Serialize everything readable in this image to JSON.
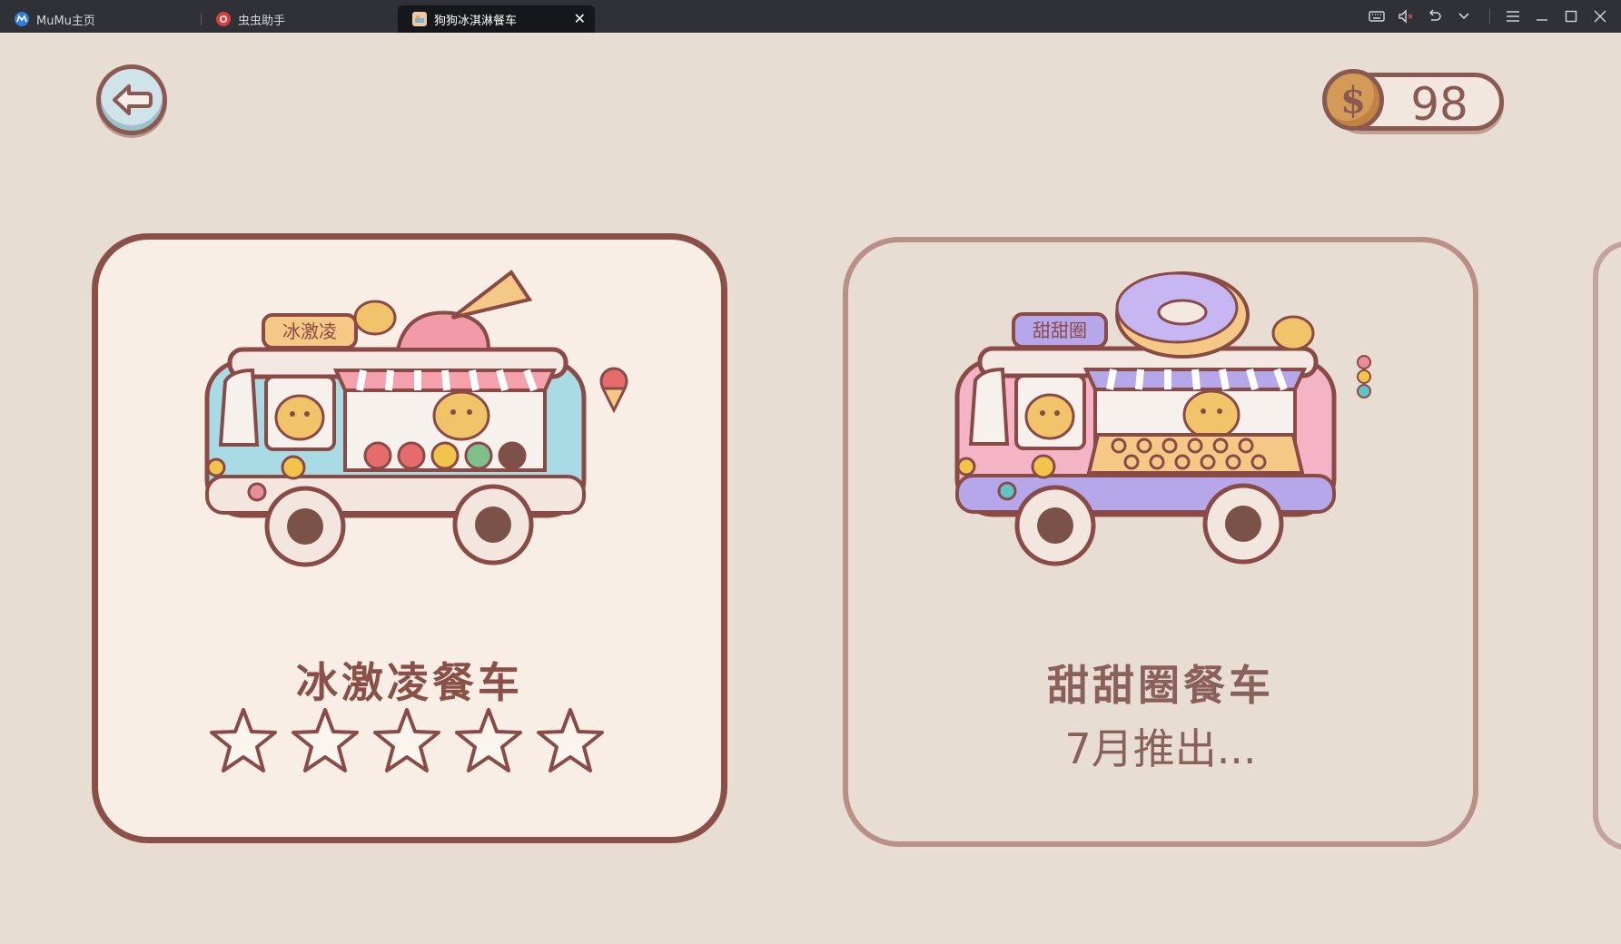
{
  "tabs": [
    {
      "label": "MuMu主页",
      "active": false
    },
    {
      "label": "虫虫助手",
      "active": false
    },
    {
      "label": "狗狗冰淇淋餐车",
      "active": true
    }
  ],
  "window_controls": [
    "keyboard-icon",
    "mute-icon",
    "undo-icon",
    "chevron-down-icon",
    "menu-icon",
    "minimize-icon",
    "maximize-icon",
    "close-icon"
  ],
  "coins": "98",
  "coin_symbol": "$",
  "cards": [
    {
      "title": "冰激凌餐车",
      "sign": "冰激凌",
      "stars_filled": 0,
      "stars_total": 5
    },
    {
      "title": "甜甜圈餐车",
      "sign": "甜甜圈",
      "status": "7月推出..."
    }
  ],
  "colors": {
    "background": "#e7ddd3",
    "outline": "#8a5048",
    "card_active": "#f8eee6",
    "truck_blue": "#a9dbe5",
    "truck_pink": "#f5b4c6",
    "awning_lilac": "#b5a7ea",
    "coin": "#d49a57"
  }
}
